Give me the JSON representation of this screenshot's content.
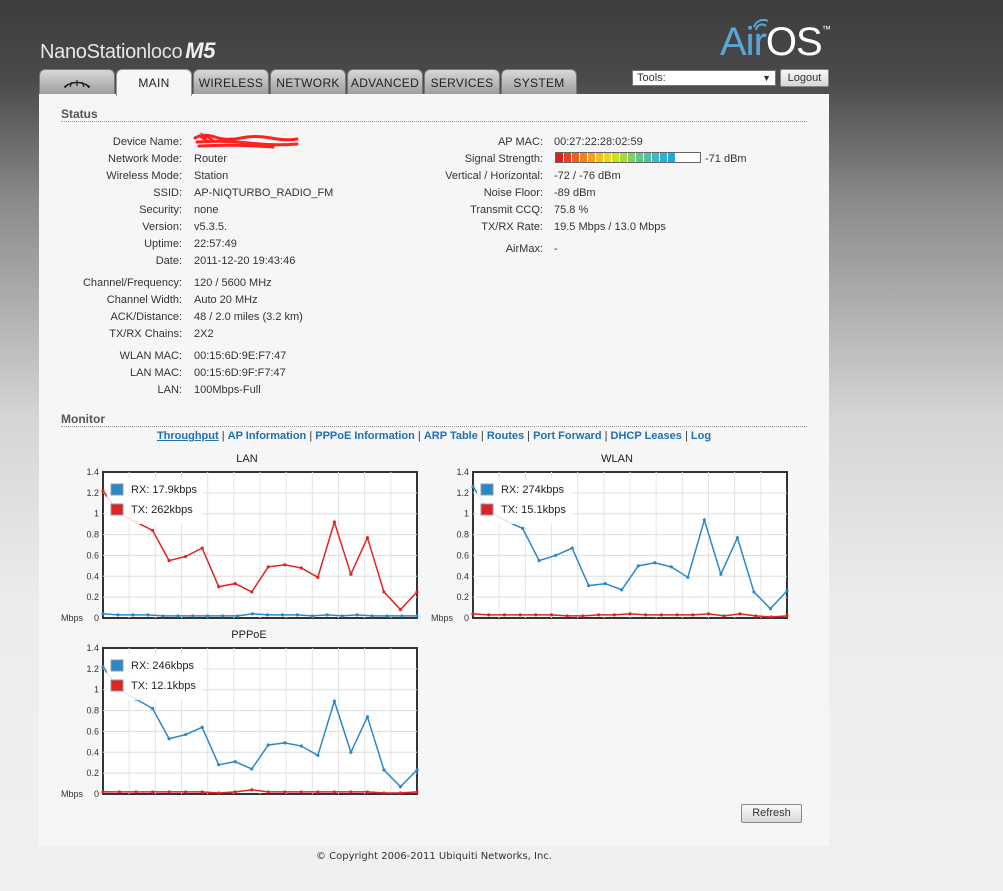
{
  "brand": {
    "name": "NanoStation",
    "variant": "loco",
    "model": "M5"
  },
  "logo": {
    "air": "Air",
    "os": "OS",
    "tm": "™"
  },
  "tabs": [
    {
      "label": "",
      "icon": "ubiquiti-logo-icon"
    },
    {
      "label": "MAIN"
    },
    {
      "label": "WIRELESS"
    },
    {
      "label": "NETWORK"
    },
    {
      "label": "ADVANCED"
    },
    {
      "label": "SERVICES"
    },
    {
      "label": "SYSTEM"
    }
  ],
  "tools": {
    "selected": "Tools:",
    "logout": "Logout"
  },
  "status": {
    "title": "Status",
    "left": [
      {
        "label": "Device Name:",
        "value": ""
      },
      {
        "label": "Network Mode:",
        "value": "Router"
      },
      {
        "label": "Wireless Mode:",
        "value": "Station"
      },
      {
        "label": "SSID:",
        "value": "AP-NIQTURBO_RADIO_FM"
      },
      {
        "label": "Security:",
        "value": "none"
      },
      {
        "label": "Version:",
        "value": "v5.3.5."
      },
      {
        "label": "Uptime:",
        "value": "22:57:49"
      },
      {
        "label": "Date:",
        "value": "2011-12-20 19:43:46"
      },
      {
        "label": "Channel/Frequency:",
        "value": "120 / 5600 MHz"
      },
      {
        "label": "Channel Width:",
        "value": "Auto 20 MHz"
      },
      {
        "label": "ACK/Distance:",
        "value": "48 / 2.0 miles (3.2 km)"
      },
      {
        "label": "TX/RX Chains:",
        "value": "2X2"
      },
      {
        "label": "WLAN MAC:",
        "value": "00:15:6D:9E:F7:47"
      },
      {
        "label": "LAN MAC:",
        "value": "00:15:6D:9F:F7:47"
      },
      {
        "label": "LAN:",
        "value": "100Mbps-Full"
      }
    ],
    "right": [
      {
        "label": "AP MAC:",
        "value": "00:27:22:28:02:59"
      },
      {
        "label": "Signal Strength:",
        "value": "-71 dBm"
      },
      {
        "label": "Vertical / Horizontal:",
        "value": "-72 / -76 dBm"
      },
      {
        "label": "Noise Floor:",
        "value": "-89 dBm"
      },
      {
        "label": "Transmit CCQ:",
        "value": "75.8 %"
      },
      {
        "label": "TX/RX Rate:",
        "value": "19.5 Mbps / 13.0 Mbps"
      },
      {
        "label": "AirMax:",
        "value": "-"
      }
    ],
    "signal_level": 0.81,
    "signal_colors": [
      "#e02020",
      "#e84020",
      "#ec6020",
      "#f08020",
      "#f4a020",
      "#f4c020",
      "#e8d820",
      "#c8e020",
      "#a8d840",
      "#80d060",
      "#60c880",
      "#50c0a0",
      "#40b8c0",
      "#30b0d0",
      "#20a8e0"
    ]
  },
  "monitor": {
    "title": "Monitor",
    "links": [
      {
        "label": "Throughput",
        "active": true
      },
      {
        "label": "AP Information"
      },
      {
        "label": "PPPoE Information"
      },
      {
        "label": "ARP Table"
      },
      {
        "label": "Routes"
      },
      {
        "label": "Port Forward"
      },
      {
        "label": "DHCP Leases"
      },
      {
        "label": "Log"
      }
    ]
  },
  "chart_data": [
    {
      "type": "line",
      "title": "LAN",
      "yunit": "Mbps",
      "ylim": [
        0,
        1.4
      ],
      "yticks": [
        "0",
        "0.2",
        "0.4",
        "0.6",
        "0.8",
        "1",
        "1.2",
        "1.4"
      ],
      "grid": true,
      "legend": "top-left",
      "series": [
        {
          "name": "RX: 17.9kbps",
          "color": "#2a88c8",
          "values": [
            0.04,
            0.03,
            0.03,
            0.03,
            0.02,
            0.02,
            0.02,
            0.02,
            0.02,
            0.02,
            0.04,
            0.03,
            0.03,
            0.03,
            0.02,
            0.03,
            0.02,
            0.03,
            0.02,
            0.02,
            0.02,
            0.02
          ]
        },
        {
          "name": "TX: 262kbps",
          "color": "#e02424",
          "values": [
            1.22,
            1.0,
            0.92,
            0.84,
            0.55,
            0.59,
            0.67,
            0.3,
            0.33,
            0.25,
            0.49,
            0.51,
            0.48,
            0.39,
            0.92,
            0.42,
            0.77,
            0.25,
            0.08,
            0.25
          ]
        }
      ]
    },
    {
      "type": "line",
      "title": "WLAN",
      "yunit": "Mbps",
      "ylim": [
        0,
        1.4
      ],
      "yticks": [
        "0",
        "0.2",
        "0.4",
        "0.6",
        "0.8",
        "1",
        "1.2",
        "1.4"
      ],
      "grid": true,
      "legend": "top-left",
      "series": [
        {
          "name": "RX: 274kbps",
          "color": "#2a88c8",
          "values": [
            1.26,
            1.02,
            0.93,
            0.86,
            0.55,
            0.6,
            0.67,
            0.31,
            0.33,
            0.27,
            0.5,
            0.53,
            0.49,
            0.39,
            0.94,
            0.42,
            0.77,
            0.25,
            0.09,
            0.26
          ]
        },
        {
          "name": "TX: 15.1kbps",
          "color": "#e02424",
          "values": [
            0.04,
            0.03,
            0.03,
            0.03,
            0.03,
            0.03,
            0.02,
            0.02,
            0.03,
            0.03,
            0.04,
            0.03,
            0.03,
            0.03,
            0.03,
            0.04,
            0.02,
            0.04,
            0.02,
            0.01,
            0.02
          ]
        }
      ]
    },
    {
      "type": "line",
      "title": "PPPoE",
      "yunit": "Mbps",
      "ylim": [
        0,
        1.4
      ],
      "yticks": [
        "0",
        "0.2",
        "0.4",
        "0.6",
        "0.8",
        "1",
        "1.2",
        "1.4"
      ],
      "grid": true,
      "legend": "top-left",
      "series": [
        {
          "name": "RX: 246kbps",
          "color": "#2a88c8",
          "values": [
            1.22,
            1.0,
            0.91,
            0.82,
            0.53,
            0.57,
            0.64,
            0.28,
            0.31,
            0.24,
            0.47,
            0.49,
            0.46,
            0.37,
            0.89,
            0.4,
            0.74,
            0.23,
            0.07,
            0.23
          ]
        },
        {
          "name": "TX: 12.1kbps",
          "color": "#e02424",
          "values": [
            0.02,
            0.02,
            0.02,
            0.02,
            0.02,
            0.02,
            0.02,
            0.01,
            0.02,
            0.04,
            0.02,
            0.02,
            0.02,
            0.02,
            0.02,
            0.02,
            0.02,
            0.01,
            0.01,
            0.02
          ]
        }
      ]
    }
  ],
  "refresh_label": "Refresh",
  "copyright": "© Copyright 2006-2011 Ubiquiti Networks, Inc."
}
